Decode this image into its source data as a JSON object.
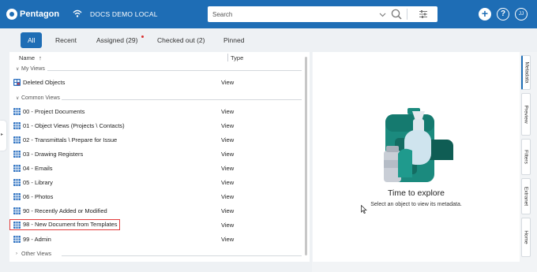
{
  "app": {
    "logo_text": "Pentagon",
    "vault_name": "DOCS DEMO LOCAL",
    "user_initials": "JJ"
  },
  "search": {
    "placeholder": "Search",
    "value": ""
  },
  "tabs": [
    {
      "label": "All",
      "active": true
    },
    {
      "label": "Recent",
      "active": false
    },
    {
      "label": "Assigned (29)",
      "active": false,
      "notification": true
    },
    {
      "label": "Checked out (2)",
      "active": false
    },
    {
      "label": "Pinned",
      "active": false
    }
  ],
  "list": {
    "col_name": "Name",
    "col_type": "Type",
    "groups": [
      {
        "label": "My Views",
        "expanded": true,
        "items": [
          {
            "name": "Deleted Objects",
            "type": "View",
            "icon": "deleted-objects-icon"
          }
        ]
      },
      {
        "label": "Common Views",
        "expanded": true,
        "items": [
          {
            "name": "00 - Project Documents",
            "type": "View"
          },
          {
            "name": "01 - Object Views (Projects \\ Contacts)",
            "type": "View"
          },
          {
            "name": "02 - Transmittals \\ Prepare for Issue",
            "type": "View"
          },
          {
            "name": "03 - Drawing Registers",
            "type": "View"
          },
          {
            "name": "04 - Emails",
            "type": "View"
          },
          {
            "name": "05 - Library",
            "type": "View"
          },
          {
            "name": "06 - Photos",
            "type": "View"
          },
          {
            "name": "90 - Recently Added or Modified",
            "type": "View"
          },
          {
            "name": "98 - New Document from Templates",
            "type": "View",
            "highlighted": true
          },
          {
            "name": "99 - Admin",
            "type": "View"
          }
        ]
      },
      {
        "label": "Other Views",
        "expanded": false,
        "items": []
      }
    ]
  },
  "right_panel": {
    "title": "Time to explore",
    "subtitle": "Select an object to view its metadata.",
    "side_tabs": [
      {
        "label": "Metadata",
        "active": true
      },
      {
        "label": "Preview",
        "active": false
      },
      {
        "label": "Filters",
        "active": false
      },
      {
        "label": "Extranet",
        "active": false
      },
      {
        "label": "Home",
        "active": false
      }
    ]
  },
  "colors": {
    "brand": "#1e6db5",
    "highlight": "#e23c3c",
    "illustration": "#1b8a7e"
  }
}
